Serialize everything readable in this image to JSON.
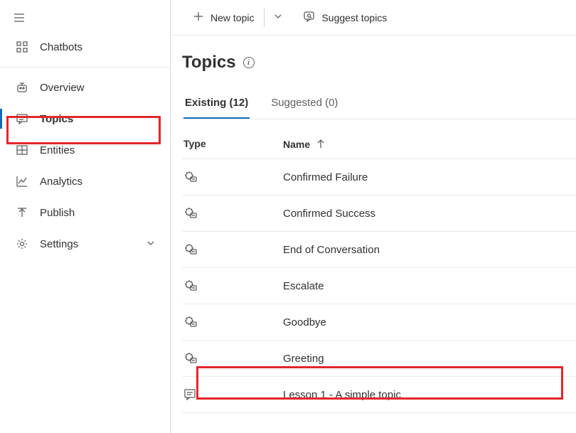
{
  "sidebar": {
    "items": [
      {
        "label": "Chatbots"
      },
      {
        "label": "Overview"
      },
      {
        "label": "Topics"
      },
      {
        "label": "Entities"
      },
      {
        "label": "Analytics"
      },
      {
        "label": "Publish"
      },
      {
        "label": "Settings"
      }
    ]
  },
  "cmdbar": {
    "new_topic": "New topic",
    "suggest_topics": "Suggest topics"
  },
  "page": {
    "title": "Topics"
  },
  "tabs": {
    "existing": "Existing (12)",
    "suggested": "Suggested (0)"
  },
  "table": {
    "header_type": "Type",
    "header_name": "Name",
    "rows": [
      {
        "name": "Confirmed Failure",
        "system": true
      },
      {
        "name": "Confirmed Success",
        "system": true
      },
      {
        "name": "End of Conversation",
        "system": true
      },
      {
        "name": "Escalate",
        "system": true
      },
      {
        "name": "Goodbye",
        "system": true
      },
      {
        "name": "Greeting",
        "system": true
      },
      {
        "name": "Lesson 1 - A simple topic",
        "system": false
      }
    ]
  }
}
